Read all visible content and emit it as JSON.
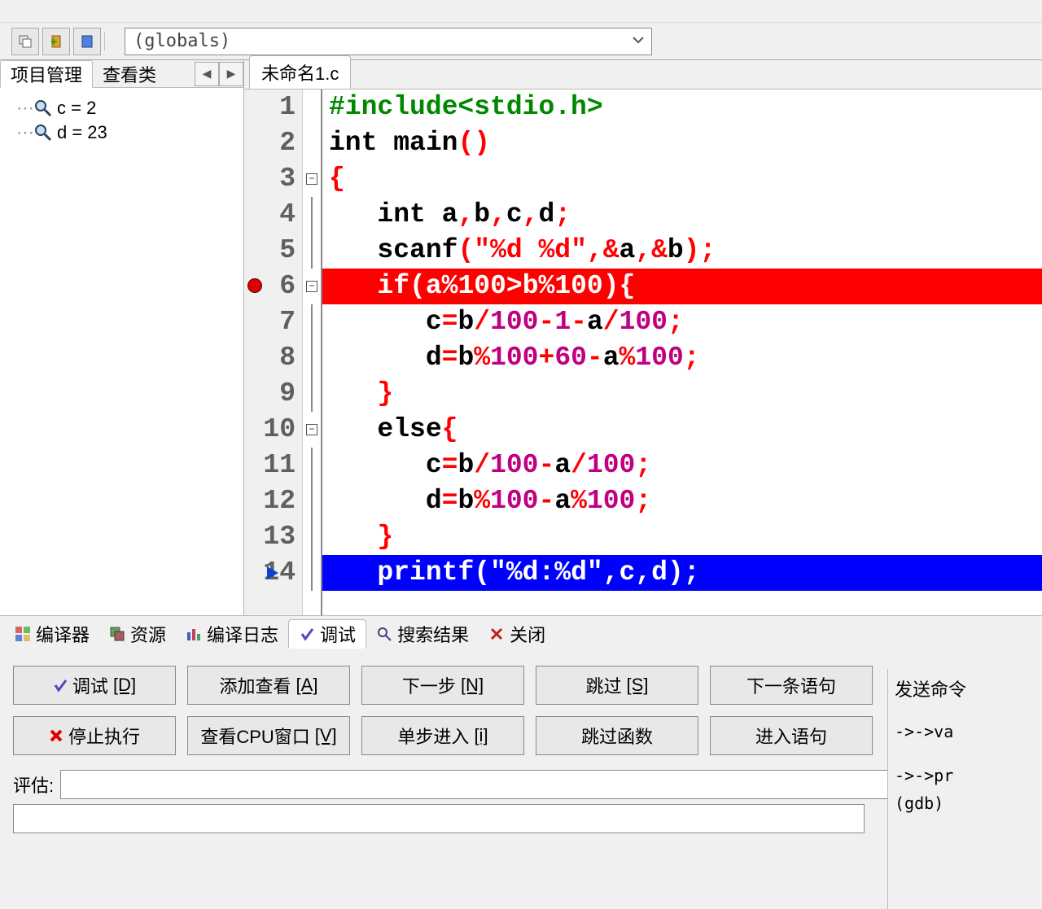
{
  "secondary_bar": {
    "scope_text": "(globals)"
  },
  "sidebar": {
    "tabs": {
      "project": "项目管理",
      "classview": "查看类"
    },
    "nav_left": "◀",
    "nav_right": "▶",
    "watches": [
      {
        "name": "c",
        "op": "=",
        "value": "2"
      },
      {
        "name": "d",
        "op": "=",
        "value": "23"
      }
    ]
  },
  "editor": {
    "filename": "未命名1.c",
    "lines": [
      {
        "n": 1,
        "fold": "",
        "type": "pre",
        "html": "#include<stdio.h>"
      },
      {
        "n": 2,
        "fold": "",
        "tokens": [
          [
            "kw",
            "int "
          ],
          [
            "id",
            "main"
          ],
          [
            "pun",
            "()"
          ]
        ]
      },
      {
        "n": 3,
        "fold": "box",
        "tokens": [
          [
            "pun",
            "{"
          ]
        ]
      },
      {
        "n": 4,
        "fold": "line",
        "tokens": [
          [
            "",
            "   "
          ],
          [
            "kw",
            "int "
          ],
          [
            "id",
            "a"
          ],
          [
            "pun",
            ","
          ],
          [
            "id",
            "b"
          ],
          [
            "pun",
            ","
          ],
          [
            "id",
            "c"
          ],
          [
            "pun",
            ","
          ],
          [
            "id",
            "d"
          ],
          [
            "pun",
            ";"
          ]
        ]
      },
      {
        "n": 5,
        "fold": "line",
        "tokens": [
          [
            "",
            "   "
          ],
          [
            "id",
            "scanf"
          ],
          [
            "pun",
            "("
          ],
          [
            "str",
            "\"%d %d\""
          ],
          [
            "pun",
            ",&"
          ],
          [
            "id",
            "a"
          ],
          [
            "pun",
            ",&"
          ],
          [
            "id",
            "b"
          ],
          [
            "pun",
            ");"
          ]
        ]
      },
      {
        "n": 6,
        "fold": "box",
        "bp": true,
        "hl": "red",
        "tokens": [
          [
            "",
            "   "
          ],
          [
            "kw",
            "if"
          ],
          [
            "pun",
            "("
          ],
          [
            "id",
            "a"
          ],
          [
            "pun",
            "%"
          ],
          [
            "num",
            "100"
          ],
          [
            "pun",
            ">"
          ],
          [
            "id",
            "b"
          ],
          [
            "pun",
            "%"
          ],
          [
            "num",
            "100"
          ],
          [
            "pun",
            "){"
          ]
        ]
      },
      {
        "n": 7,
        "fold": "line",
        "tokens": [
          [
            "",
            "      "
          ],
          [
            "id",
            "c"
          ],
          [
            "pun",
            "="
          ],
          [
            "id",
            "b"
          ],
          [
            "pun",
            "/"
          ],
          [
            "num",
            "100"
          ],
          [
            "pun",
            "-"
          ],
          [
            "num",
            "1"
          ],
          [
            "pun",
            "-"
          ],
          [
            "id",
            "a"
          ],
          [
            "pun",
            "/"
          ],
          [
            "num",
            "100"
          ],
          [
            "pun",
            ";"
          ]
        ]
      },
      {
        "n": 8,
        "fold": "line",
        "tokens": [
          [
            "",
            "      "
          ],
          [
            "id",
            "d"
          ],
          [
            "pun",
            "="
          ],
          [
            "id",
            "b"
          ],
          [
            "pun",
            "%"
          ],
          [
            "num",
            "100"
          ],
          [
            "pun",
            "+"
          ],
          [
            "num",
            "60"
          ],
          [
            "pun",
            "-"
          ],
          [
            "id",
            "a"
          ],
          [
            "pun",
            "%"
          ],
          [
            "num",
            "100"
          ],
          [
            "pun",
            ";"
          ]
        ]
      },
      {
        "n": 9,
        "fold": "line",
        "tokens": [
          [
            "",
            "   "
          ],
          [
            "pun",
            "}"
          ]
        ]
      },
      {
        "n": 10,
        "fold": "box",
        "tokens": [
          [
            "",
            "   "
          ],
          [
            "kw",
            "else"
          ],
          [
            "pun",
            "{"
          ]
        ]
      },
      {
        "n": 11,
        "fold": "line",
        "tokens": [
          [
            "",
            "      "
          ],
          [
            "id",
            "c"
          ],
          [
            "pun",
            "="
          ],
          [
            "id",
            "b"
          ],
          [
            "pun",
            "/"
          ],
          [
            "num",
            "100"
          ],
          [
            "pun",
            "-"
          ],
          [
            "id",
            "a"
          ],
          [
            "pun",
            "/"
          ],
          [
            "num",
            "100"
          ],
          [
            "pun",
            ";"
          ]
        ]
      },
      {
        "n": 12,
        "fold": "line",
        "tokens": [
          [
            "",
            "      "
          ],
          [
            "id",
            "d"
          ],
          [
            "pun",
            "="
          ],
          [
            "id",
            "b"
          ],
          [
            "pun",
            "%"
          ],
          [
            "num",
            "100"
          ],
          [
            "pun",
            "-"
          ],
          [
            "id",
            "a"
          ],
          [
            "pun",
            "%"
          ],
          [
            "num",
            "100"
          ],
          [
            "pun",
            ";"
          ]
        ]
      },
      {
        "n": 13,
        "fold": "line",
        "tokens": [
          [
            "",
            "   "
          ],
          [
            "pun",
            "}"
          ]
        ]
      },
      {
        "n": 14,
        "fold": "line",
        "arrow": true,
        "hl": "blue",
        "tokens": [
          [
            "",
            "   "
          ],
          [
            "id",
            "printf"
          ],
          [
            "pun",
            "("
          ],
          [
            "str",
            "\"%d:%d\""
          ],
          [
            "pun",
            ","
          ],
          [
            "id",
            "c"
          ],
          [
            "pun",
            ","
          ],
          [
            "id",
            "d"
          ],
          [
            "pun",
            ");"
          ]
        ]
      }
    ]
  },
  "bottom_tabs": {
    "compiler": "编译器",
    "resources": "资源",
    "compilelog": "编译日志",
    "debug": "调试",
    "searchresults": "搜索结果",
    "close": "关闭"
  },
  "debug_buttons": {
    "debug": "调试",
    "debug_k": "[D]",
    "addwatch": "添加查看",
    "addwatch_k": "[A]",
    "next": "下一步",
    "next_k": "[N]",
    "stepover": "跳过",
    "stepover_k": "[S]",
    "nextstmt": "下一条语句",
    "stop": "停止执行",
    "cpu": "查看CPU窗口",
    "cpu_k": "[V]",
    "stepinto": "单步进入",
    "stepinto_k": "[i]",
    "stepoverfn": "跳过函数",
    "intostmt": "进入语句"
  },
  "eval": {
    "label": "评估:",
    "value": ""
  },
  "right_panel": {
    "title": "发送命令",
    "log1": "->->va",
    "log2": "->->pr",
    "log3": "(gdb)"
  }
}
